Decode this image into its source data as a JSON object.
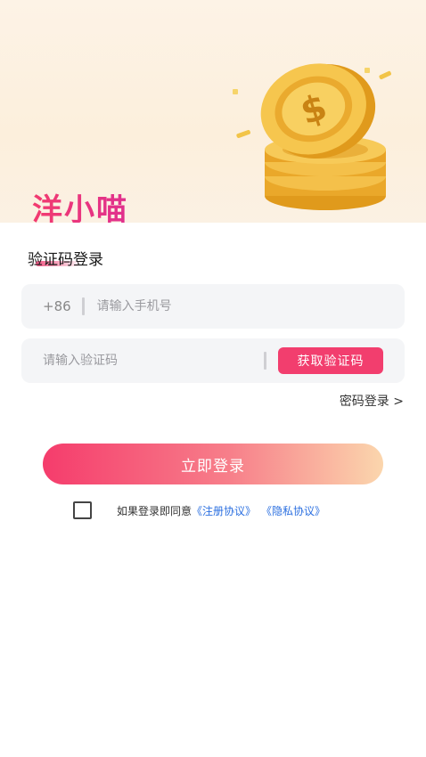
{
  "brand": {
    "name": "洋小喵"
  },
  "login": {
    "section_title": "验证码登录",
    "phone": {
      "prefix": "+86",
      "placeholder": "请输入手机号",
      "value": ""
    },
    "code": {
      "placeholder": "请输入验证码",
      "value": ""
    },
    "get_code_label": "获取验证码",
    "password_login_link": "密码登录 >",
    "submit_label": "立即登录"
  },
  "agreement": {
    "checked": false,
    "text": "如果登录即同意",
    "register_link": "《注册协议》",
    "privacy_link": "《隐私协议》"
  },
  "colors": {
    "accent": "#f23e6e",
    "link": "#2b6fe0",
    "field_bg": "#f4f5f7"
  },
  "icons": [
    "coin-stack-illustration"
  ]
}
